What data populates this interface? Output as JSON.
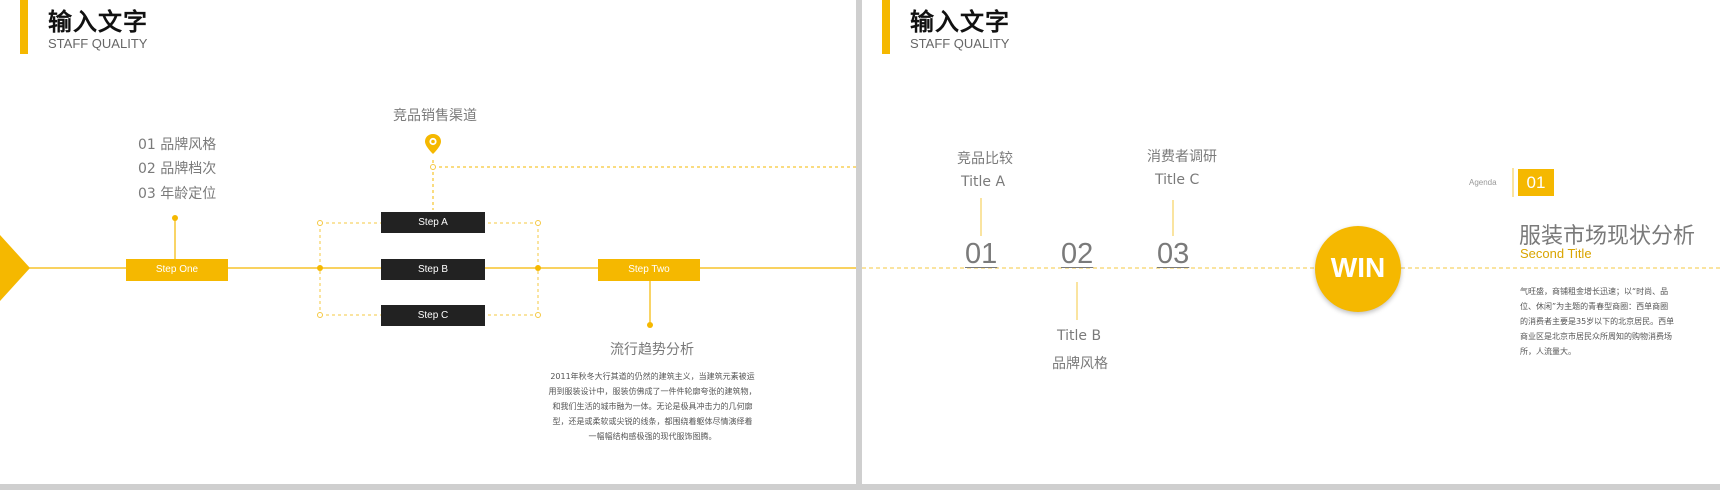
{
  "left_slide": {
    "header": {
      "title": "输入文字",
      "subtitle": "STAFF QUALITY"
    },
    "list_items": [
      "01 品牌风格",
      "02 品牌档次",
      "03 年龄定位"
    ],
    "channel_title": "竞品销售渠道",
    "step_one": "Step One",
    "step_two": "Step Two",
    "steps": [
      "Step A",
      "Step B",
      "Step C"
    ],
    "trend_title": "流行趋势分析",
    "trend_text": [
      "2011年秋冬大行其道的仍然的建筑主义，当建筑元素被运",
      "用到服装设计中，服装仿佛成了一件件轮廓夸张的建筑物，",
      "和我们生活的城市融为一体。无论是极具冲击力的几何廓",
      "型，还是或柔软或尖锐的线条，都围绕着躯体尽情演绎着",
      "一幅幅结构感极强的现代服饰图腾。"
    ],
    "colors": {
      "accent": "#f5b800",
      "dark_box": "#222222",
      "text_gray": "#7a7a7a"
    }
  },
  "right_slide": {
    "header": {
      "title": "输入文字",
      "subtitle": "STAFF QUALITY"
    },
    "milestones": [
      {
        "number": "01",
        "label_top": "竞品比较",
        "label_sub": "Title A"
      },
      {
        "number": "02",
        "label_top": "Title B",
        "label_sub": "品牌风格"
      },
      {
        "number": "03",
        "label_top": "消费者调研",
        "label_sub": "Title C"
      }
    ],
    "win_label": "WIN",
    "agenda_label": "Agenda",
    "agenda_number": "01",
    "main_title": "服装市场现状分析",
    "second_title": "Second Title",
    "description": [
      "气旺盛，商铺租金增长迅速；以“时尚、品",
      "位、休闲”为主题的青春型商圈：西单商圈",
      "的消费者主要是35岁以下的北京居民。西单",
      "商业区是北京市居民众所周知的购物消费场",
      "所，人流量大。"
    ]
  }
}
